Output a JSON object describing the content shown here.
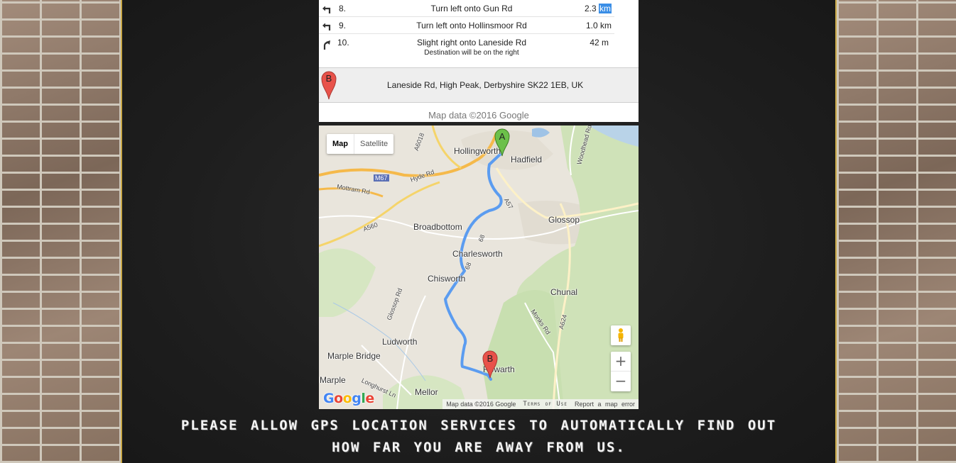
{
  "directions": {
    "steps": [
      {
        "num": "8.",
        "instruction": "Turn left onto Gun Rd",
        "sub": "",
        "distance_value": "2.3",
        "distance_unit": "km",
        "icon": "turn-left-icon"
      },
      {
        "num": "9.",
        "instruction": "Turn left onto Hollinsmoor Rd",
        "sub": "",
        "distance_value": "1.0 km",
        "distance_unit": "",
        "icon": "turn-left-icon"
      },
      {
        "num": "10.",
        "instruction": "Slight right onto Laneside Rd",
        "sub": "Destination will be on the right",
        "distance_value": "42 m",
        "distance_unit": "",
        "icon": "slight-right-icon"
      }
    ],
    "destination": {
      "marker": "B",
      "address": "Laneside Rd, High Peak, Derbyshire SK22 1EB, UK"
    },
    "map_data": "Map data ©2016 Google"
  },
  "map": {
    "type_controls": {
      "map": "Map",
      "satellite": "Satellite"
    },
    "markers": {
      "start": "A",
      "end": "B"
    },
    "places": {
      "hollingworth": "Hollingworth",
      "hadfield": "Hadfield",
      "glossop": "Glossop",
      "broadbottom": "Broadbottom",
      "charlesworth": "Charlesworth",
      "chisworth": "Chisworth",
      "chunal": "Chunal",
      "ludworth": "Ludworth",
      "marple_bridge": "Marple Bridge",
      "marple": "Marple",
      "mellor": "Mellor",
      "rowarth": "Rowarth"
    },
    "roads": {
      "a6018": "A6018",
      "m67": "M67",
      "hyde_rd": "Hyde Rd",
      "mottram_rd": "Mottram Rd",
      "a560": "A560",
      "a57": "A57",
      "b6174": "68",
      "glossop_rd": "Glossop Rd",
      "monks_rd": "Monks Rd",
      "a624": "A624",
      "woodhead_rd": "Woodhead Rd",
      "longhurst_ln": "Longhurst Ln"
    },
    "zoom": {
      "in": "+",
      "out": "−"
    },
    "footer": {
      "map_data": "Map data ©2016 Google",
      "terms": "Terms of Use",
      "report": "Report a map error"
    },
    "logo": "Google",
    "colors": {
      "route": "#5b9cf0",
      "park_green": "#c8dfb0",
      "motorway": "#f5b94a"
    }
  },
  "message": {
    "line1": "Please allow GPS location services to automatically find out",
    "line2": "how far you are away from us."
  }
}
